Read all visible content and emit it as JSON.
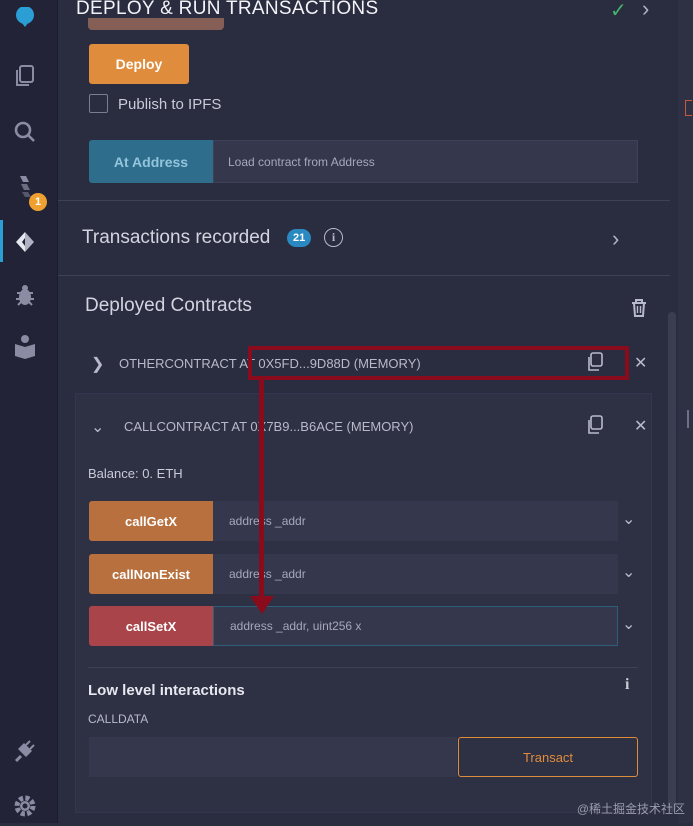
{
  "header": {
    "title": "DEPLOY & RUN TRANSACTIONS"
  },
  "deploy": {
    "deploy_label": "Deploy",
    "publish_label": "Publish to IPFS",
    "at_address_label": "At Address",
    "at_address_placeholder": "Load contract from Address"
  },
  "transactions": {
    "label": "Transactions recorded",
    "count": "21"
  },
  "deployed": {
    "label": "Deployed Contracts",
    "contracts": [
      {
        "title": "OTHERCONTRACT AT 0X5FD...9D88D (MEMORY)",
        "expanded": false
      },
      {
        "title": "CALLCONTRACT AT 0X7B9...B6ACE (MEMORY)",
        "expanded": true
      }
    ],
    "balance": "Balance: 0. ETH",
    "functions": [
      {
        "label": "callGetX",
        "placeholder": "address _addr",
        "color": "#b8703e"
      },
      {
        "label": "callNonExist",
        "placeholder": "address _addr",
        "color": "#b8703e"
      },
      {
        "label": "callSetX",
        "placeholder": "address _addr, uint256 x",
        "color": "#a8444a"
      }
    ],
    "low_level": {
      "title": "Low level interactions",
      "calldata_label": "CALLDATA",
      "transact_label": "Transact"
    }
  },
  "sidebar": {
    "badge": "1",
    "icons": [
      "remix-logo-icon",
      "file-explorer-icon",
      "search-icon",
      "solidity-compiler-icon",
      "deploy-run-icon",
      "debugger-icon",
      "learneth-icon",
      "plugin-manager-icon",
      "settings-icon"
    ]
  },
  "watermark": "@稀土掘金技术社区",
  "colors": {
    "accent_orange": "#e08c3d",
    "accent_blue": "#2b89c2",
    "annotation": "#8a0c1c"
  }
}
